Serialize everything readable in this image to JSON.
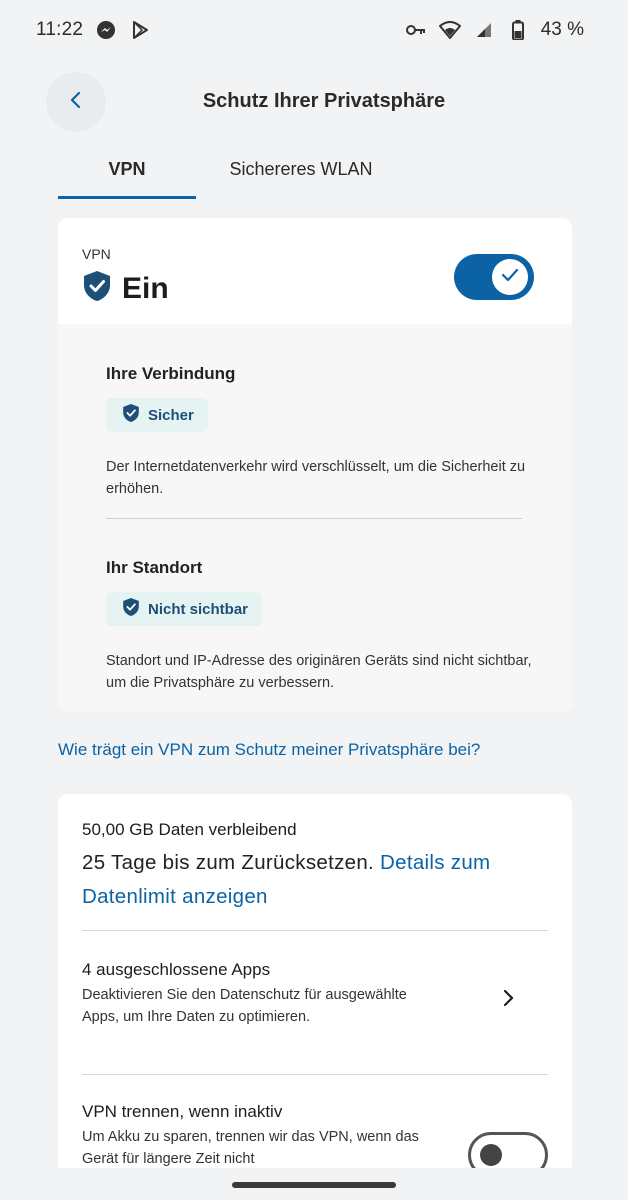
{
  "status_bar": {
    "time": "11:22",
    "battery": "43 %",
    "icons_left": [
      "messenger-icon",
      "play-store-icon"
    ],
    "icons_right": [
      "vpn-key-icon",
      "wifi-icon",
      "signal-icon",
      "battery-icon"
    ]
  },
  "header": {
    "title": "Schutz Ihrer Privatsphäre",
    "back_icon": "chevron-left-icon"
  },
  "tabs": [
    {
      "label": "VPN",
      "selected": true
    },
    {
      "label": "Sichereres WLAN",
      "selected": false
    }
  ],
  "vpn_card": {
    "overline": "VPN",
    "state": "Ein",
    "toggle_on": true,
    "connection": {
      "heading": "Ihre Verbindung",
      "chip": "Sicher",
      "text": "Der Internetdatenverkehr wird verschlüsselt, um die Sicherheit zu erhöhen."
    },
    "location": {
      "heading": "Ihr Standort",
      "chip": "Nicht sichtbar",
      "text": "Standort und IP-Adresse des originären Geräts sind nicht sichtbar, um die Privatsphäre zu verbessern."
    }
  },
  "help_link": "Wie trägt ein VPN zum Schutz meiner Privatsphäre bei?",
  "settings_card": {
    "data_remaining": "50,00 GB Daten verbleibend",
    "reset_text": "25 Tage bis zum Zurücksetzen.",
    "details_link": "Details zum Datenlimit anzeigen",
    "excluded_apps": {
      "title": "4 ausgeschlossene Apps",
      "desc": "Deaktivieren Sie den Datenschutz für ausgewählte Apps, um Ihre Daten zu optimieren."
    },
    "disconnect": {
      "title": "VPN trennen, wenn inaktiv",
      "desc": "Um Akku zu sparen, trennen wir das VPN, wenn das Gerät für längere Zeit nicht",
      "toggle_on": false
    }
  },
  "colors": {
    "accent": "#0b63a5",
    "chip_bg": "#e5f4f2",
    "shield": "#1d4f77",
    "background": "#f2f3f5"
  }
}
